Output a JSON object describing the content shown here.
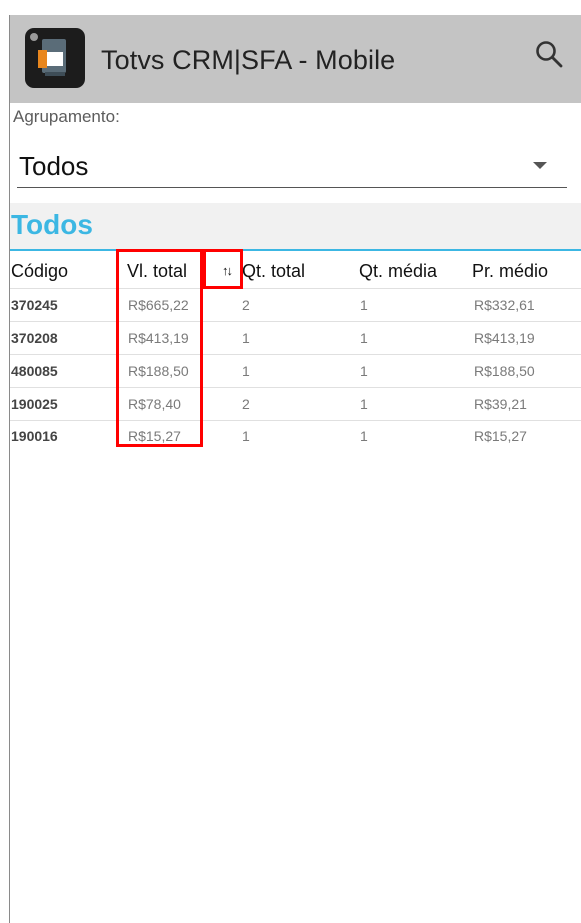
{
  "app": {
    "title": "Totvs CRM|SFA - Mobile"
  },
  "grouping": {
    "label": "Agrupamento:",
    "selected": "Todos"
  },
  "section": {
    "title": "Todos"
  },
  "table": {
    "headers": {
      "code": "Código",
      "vl_total": "Vl. total",
      "sort_glyph": "↑↓",
      "qt_total": "Qt. total",
      "qt_media": "Qt. média",
      "pr_medio": "Pr. médio"
    },
    "rows": [
      {
        "code": "370245",
        "vl_total": "R$665,22",
        "qt_total": "2",
        "qt_media": "1",
        "pr_medio": "R$332,61"
      },
      {
        "code": "370208",
        "vl_total": "R$413,19",
        "qt_total": "1",
        "qt_media": "1",
        "pr_medio": "R$413,19"
      },
      {
        "code": "480085",
        "vl_total": "R$188,50",
        "qt_total": "1",
        "qt_media": "1",
        "pr_medio": "R$188,50"
      },
      {
        "code": "190025",
        "vl_total": "R$78,40",
        "qt_total": "2",
        "qt_media": "1",
        "pr_medio": "R$39,21"
      },
      {
        "code": "190016",
        "vl_total": "R$15,27",
        "qt_total": "1",
        "qt_media": "1",
        "pr_medio": "R$15,27"
      }
    ]
  },
  "colors": {
    "accent": "#3cb7e3",
    "appbar": "#c4c4c4",
    "highlight": "#ff0000"
  },
  "icons": {
    "app": "document-app-icon",
    "search": "search-icon",
    "dropdown": "chevron-down-icon",
    "sort": "sort-icon"
  }
}
